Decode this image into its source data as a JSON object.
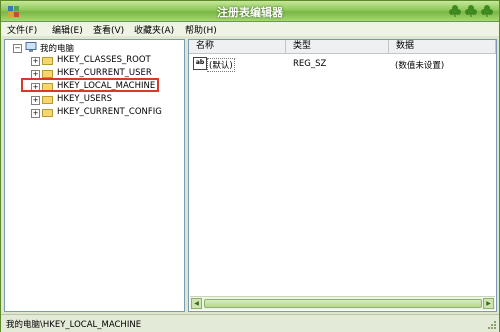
{
  "window": {
    "title": "注册表编辑器"
  },
  "menu": [
    "文件(F)",
    "编辑(E)",
    "查看(V)",
    "收藏夹(A)",
    "帮助(H)"
  ],
  "tree": {
    "root": "我的电脑",
    "items": [
      "HKEY_CLASSES_ROOT",
      "HKEY_CURRENT_USER",
      "HKEY_LOCAL_MACHINE",
      "HKEY_USERS",
      "HKEY_CURRENT_CONFIG"
    ],
    "highlighted": "HKEY_LOCAL_MACHINE"
  },
  "values_pane": {
    "columns": [
      "名称",
      "类型",
      "数据"
    ],
    "rows": [
      {
        "name": "(默认)",
        "type": "REG_SZ",
        "data": "(数值未设置)"
      }
    ]
  },
  "status": {
    "path": "我的电脑\\HKEY_LOCAL_MACHINE"
  },
  "colors": {
    "title_gradient": "#79b745",
    "highlight_box": "#d63b2a",
    "folder": "#f5d76e"
  },
  "icons": {
    "app": "regedit-icon",
    "window_controls": [
      "clover-icon",
      "clover-icon",
      "clover-icon"
    ]
  }
}
